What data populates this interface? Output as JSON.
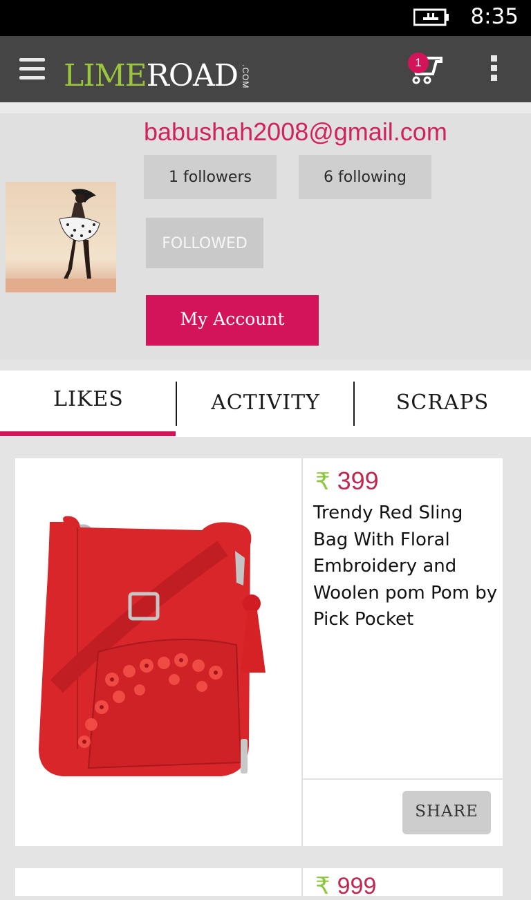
{
  "status_bar": {
    "time": "8:35",
    "battery_icon": "battery-charging-icon"
  },
  "app_bar": {
    "menu_icon": "hamburger-menu-icon",
    "logo": {
      "part1": "LIME",
      "part2": "ROAD",
      "suffix": ".COM"
    },
    "cart": {
      "icon": "shopping-cart-icon",
      "badge": "1"
    },
    "overflow_icon": "more-vertical-icon"
  },
  "profile": {
    "email": "babushah2008@gmail.com",
    "followers_label": "1 followers",
    "following_label": "6 following",
    "followed_label": "FOLLOWED",
    "my_account_label": "My Account"
  },
  "tabs": [
    {
      "label": "LIKES",
      "active": true
    },
    {
      "label": "ACTIVITY",
      "active": false
    },
    {
      "label": "SCRAPS",
      "active": false
    }
  ],
  "products": [
    {
      "currency": "₹",
      "price": "399",
      "title": "Trendy Red Sling Bag With Floral Embroidery and Woolen pom Pom by Pick Pocket",
      "share_label": "SHARE"
    },
    {
      "currency": "₹",
      "price": "999"
    }
  ],
  "colors": {
    "accent": "#d4145a",
    "brand_green": "#9bc53d",
    "appbar": "#454545"
  }
}
